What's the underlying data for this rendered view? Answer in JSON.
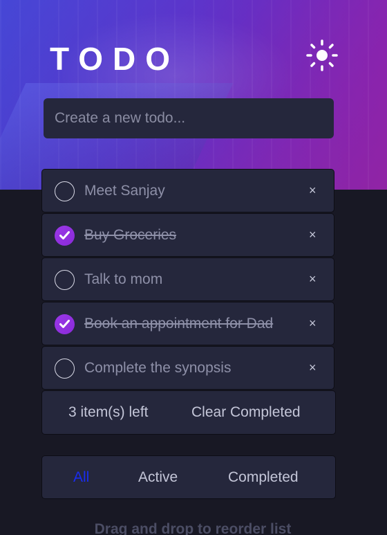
{
  "header": {
    "title": "TODO",
    "theme_toggle_icon": "sun-icon"
  },
  "new_todo": {
    "placeholder": "Create a new todo...",
    "value": ""
  },
  "todos": [
    {
      "text": "Meet Sanjay",
      "completed": false
    },
    {
      "text": "Buy Groceries",
      "completed": true
    },
    {
      "text": "Talk to mom",
      "completed": false
    },
    {
      "text": "Book an appointment for Dad",
      "completed": true
    },
    {
      "text": "Complete the synopsis",
      "completed": false
    }
  ],
  "footer": {
    "items_left": "3 item(s) left",
    "clear_completed": "Clear Completed"
  },
  "filters": {
    "all": "All",
    "active": "Active",
    "completed": "Completed",
    "selected": "All"
  },
  "hint": "Drag and drop to reorder list",
  "colors": {
    "accent": "#8a2ad8",
    "active_filter": "#1a2cf0",
    "card_bg": "#25273c",
    "page_bg": "#181824"
  },
  "delete_symbol": "×"
}
